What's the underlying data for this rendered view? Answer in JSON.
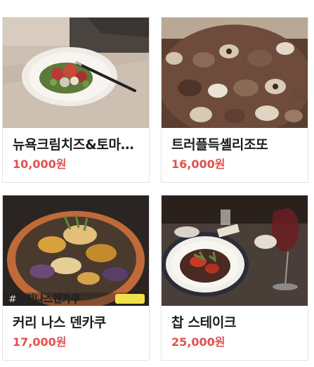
{
  "menu": {
    "items": [
      {
        "name": "뉴욕크림치즈&토마토샐러드",
        "price": "10,000원",
        "image_label": ""
      },
      {
        "name": "트러플득셸리조또",
        "price": "16,000원",
        "image_label": ""
      },
      {
        "name": "커리 나스 덴카쿠",
        "price": "17,000원",
        "image_label": "#커리나스덴카쿠"
      },
      {
        "name": "찹 스테이크",
        "price": "25,000원",
        "image_label": ""
      }
    ]
  },
  "colors": {
    "price": "#e0524f",
    "name": "#1d1d1d",
    "border": "#e4e4e4"
  }
}
